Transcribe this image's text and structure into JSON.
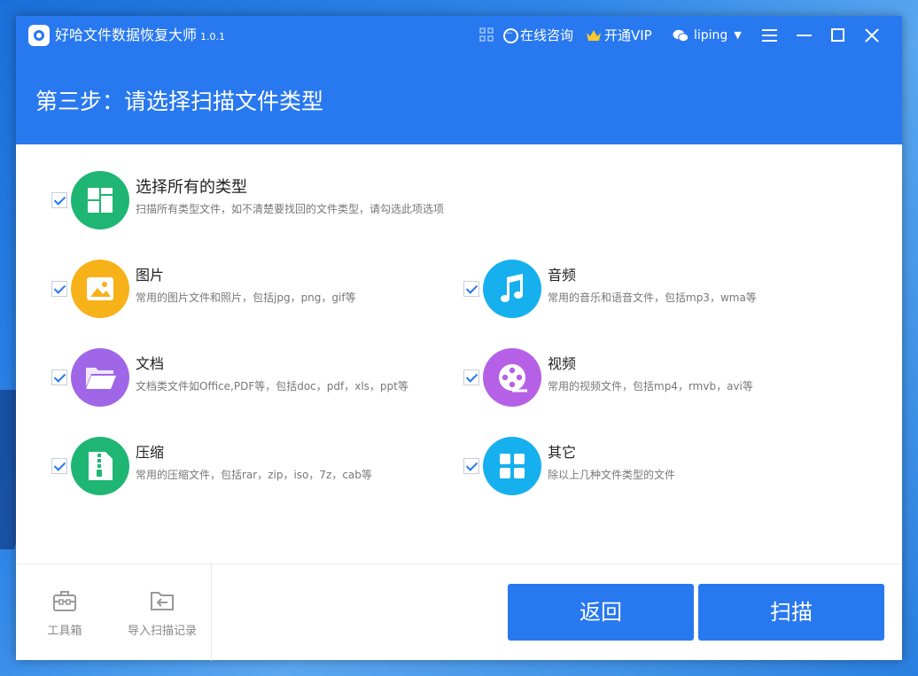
{
  "app": {
    "title": "好哈文件数据恢复大师",
    "version": "1.0.1"
  },
  "titlebar": {
    "consult": "在线咨询",
    "vip": "开通VIP",
    "user": "liping"
  },
  "step_title": "第三步：请选择扫描文件类型",
  "options": {
    "all": {
      "title": "选择所有的类型",
      "desc": "扫描所有类型文件，如不清楚要找回的文件类型，请勾选此项选项",
      "color": "#1fb673"
    },
    "image": {
      "title": "图片",
      "desc": "常用的图片文件和照片，包括jpg，png，gif等",
      "color": "#f7b219"
    },
    "audio": {
      "title": "音频",
      "desc": "常用的音乐和语音文件，包括mp3，wma等",
      "color": "#17b0ef"
    },
    "doc": {
      "title": "文档",
      "desc": "文档类文件如Office,PDF等，包括doc，pdf，xls，ppt等",
      "color": "#a066e8"
    },
    "video": {
      "title": "视频",
      "desc": "常用的视频文件，包括mp4，rmvb，avi等",
      "color": "#b560e6"
    },
    "zip": {
      "title": "压缩",
      "desc": "常用的压缩文件，包括rar，zip，iso，7z，cab等",
      "color": "#1fb673"
    },
    "other": {
      "title": "其它",
      "desc": "除以上几种文件类型的文件",
      "color": "#17b0ef"
    }
  },
  "footer": {
    "toolbox": "工具箱",
    "import": "导入扫描记录",
    "back": "返回",
    "scan": "扫描"
  },
  "accent": "#2878f0"
}
